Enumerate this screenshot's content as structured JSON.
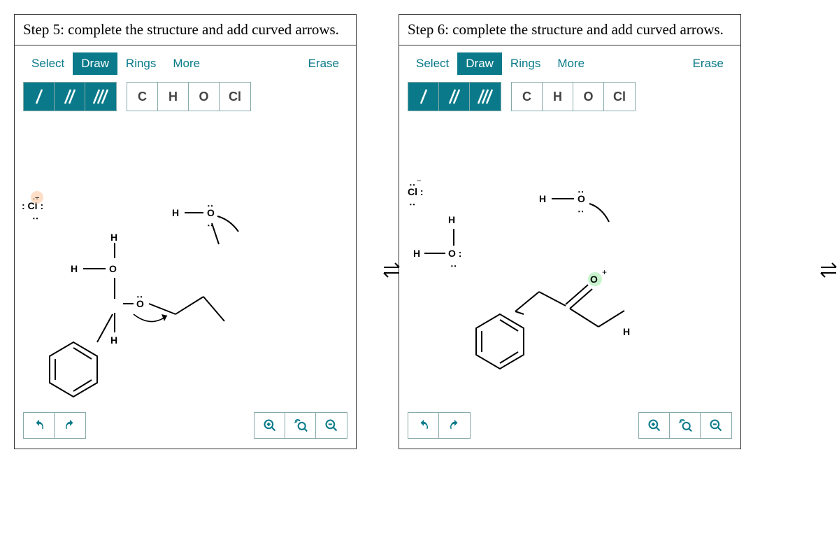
{
  "steps": [
    {
      "title": "Step 5: complete the structure and add curved arrows.",
      "tabs": {
        "select": "Select",
        "draw": "Draw",
        "rings": "Rings",
        "more": "More"
      },
      "erase": "Erase",
      "atoms": {
        "c": "C",
        "h": "H",
        "o": "O",
        "cl": "Cl"
      }
    },
    {
      "title": "Step 6: complete the structure and add curved arrows.",
      "tabs": {
        "select": "Select",
        "draw": "Draw",
        "rings": "Rings",
        "more": "More"
      },
      "erase": "Erase",
      "atoms": {
        "c": "C",
        "h": "H",
        "o": "O",
        "cl": "Cl"
      }
    }
  ],
  "labels": {
    "cl_minus": ": Cl :",
    "cl_lone": "Cl :",
    "h": "H",
    "o": "O"
  }
}
